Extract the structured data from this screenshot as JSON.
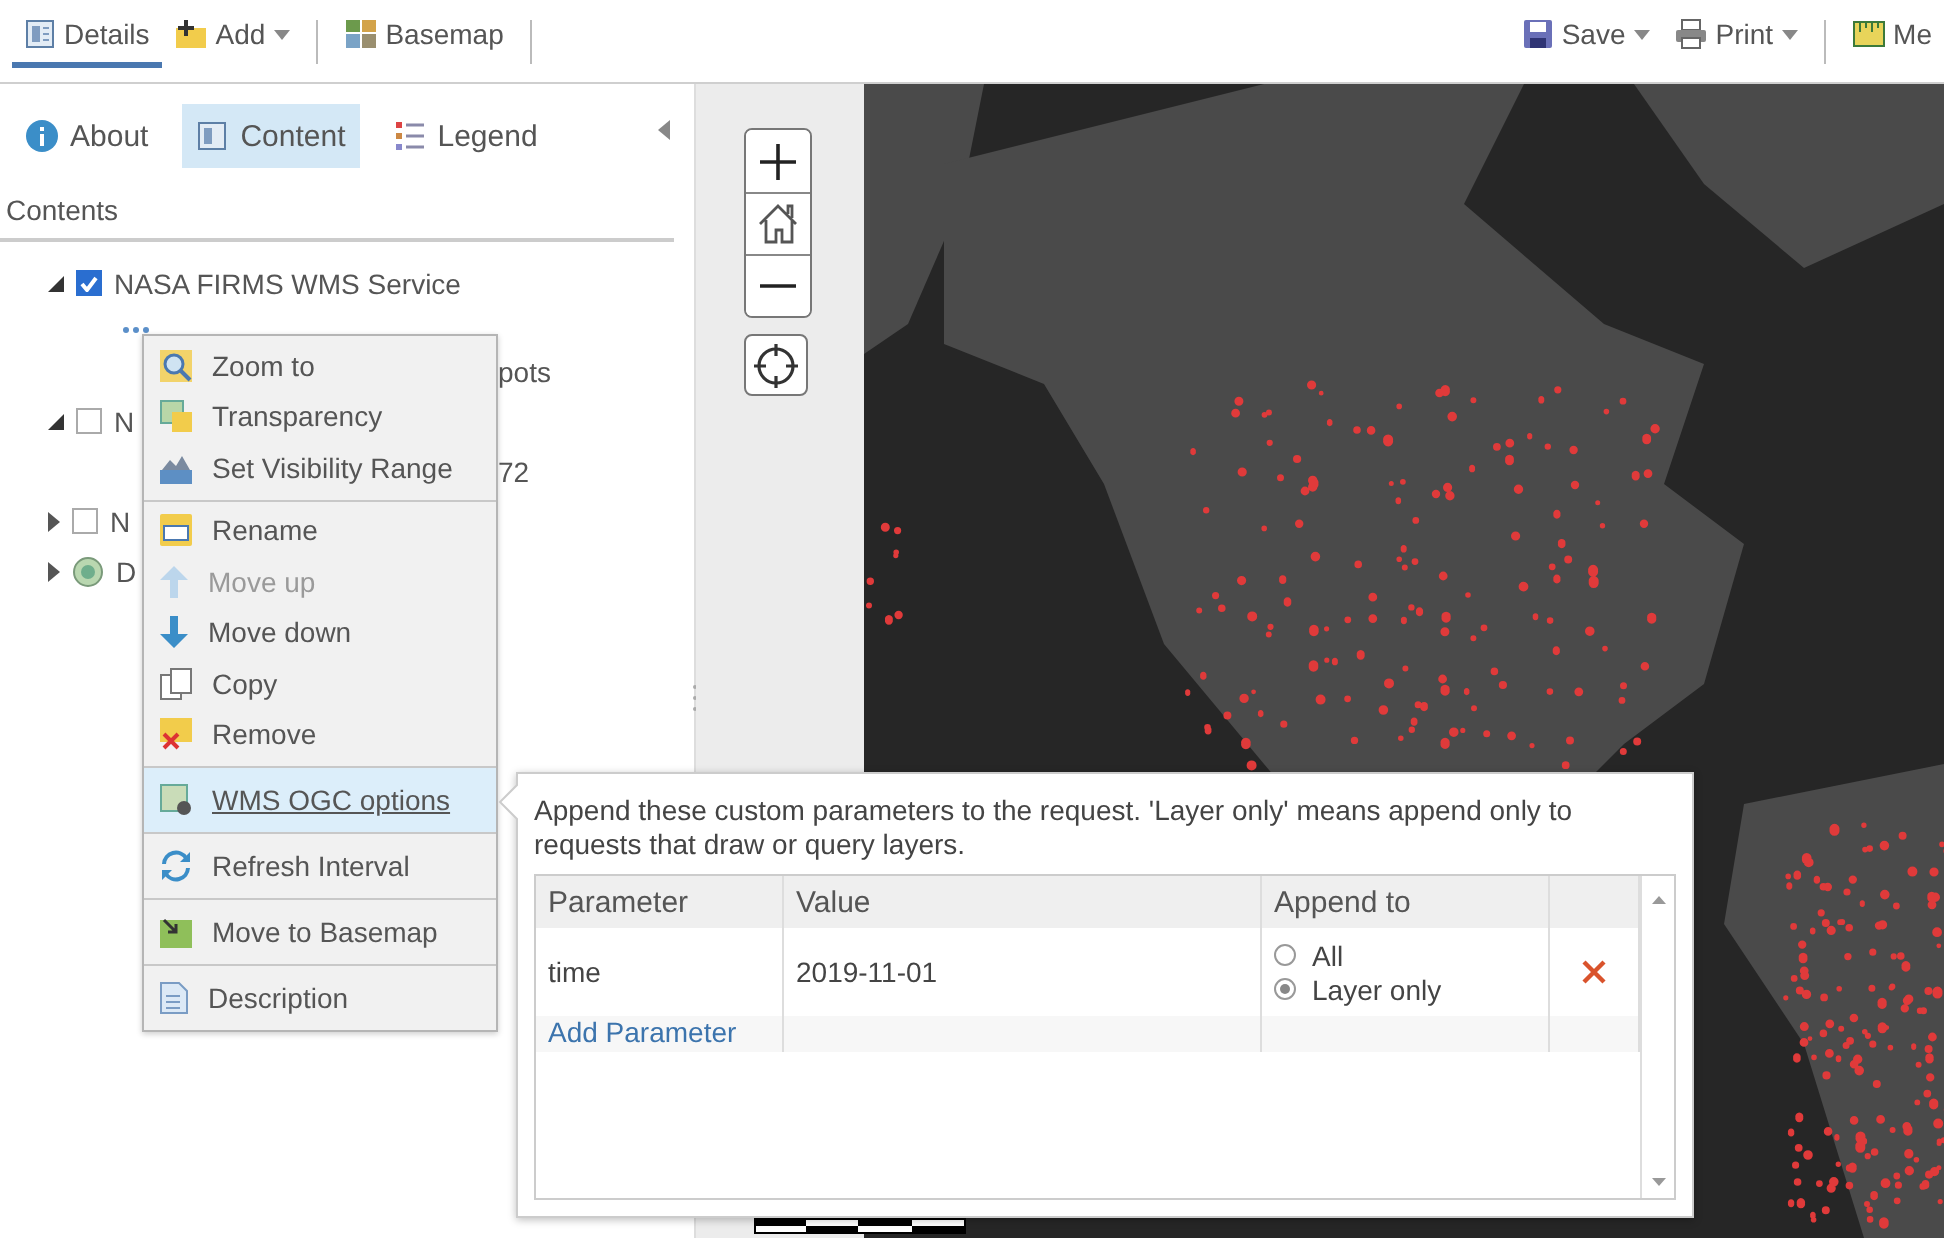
{
  "toolbar": {
    "left": [
      {
        "kind": "button",
        "label": "Details",
        "selected": true,
        "dropdown": false
      },
      {
        "kind": "button",
        "label": "Add",
        "selected": false,
        "dropdown": true
      },
      {
        "kind": "separator"
      },
      {
        "kind": "button",
        "label": "Basemap",
        "selected": false,
        "dropdown": false
      },
      {
        "kind": "separator"
      }
    ],
    "right": [
      {
        "kind": "button",
        "label": "Save",
        "selected": false,
        "dropdown": true
      },
      {
        "kind": "button",
        "label": "Print",
        "selected": false,
        "dropdown": true
      },
      {
        "kind": "separator"
      },
      {
        "kind": "button",
        "label": "Me",
        "selected": false,
        "dropdown": false
      }
    ]
  },
  "side_panel": {
    "tabs": [
      {
        "label": "About",
        "selected": false
      },
      {
        "label": "Content",
        "selected": true
      },
      {
        "label": "Legend",
        "selected": false
      }
    ],
    "heading": "Contents",
    "layers": [
      {
        "kind": "layer",
        "label": "NASA FIRMS WMS Service",
        "checked": true,
        "expanded": true,
        "options_open": true,
        "children": [
          {
            "label": "pots"
          }
        ]
      },
      {
        "kind": "layer",
        "label": "N",
        "checked": false,
        "expanded": true,
        "options_open": false,
        "children": [
          {
            "label": "72"
          }
        ]
      },
      {
        "kind": "layer",
        "label": "N",
        "checked": false,
        "expanded": false,
        "options_open": false
      },
      {
        "kind": "basemap",
        "label": "D",
        "expanded": false,
        "options_open": false
      }
    ]
  },
  "layer_menu": {
    "groups": [
      [
        {
          "label": "Zoom to",
          "disabled": false,
          "selected": false
        },
        {
          "label": "Transparency",
          "disabled": false,
          "selected": false
        },
        {
          "label": "Set Visibility Range",
          "disabled": false,
          "selected": false
        }
      ],
      [
        {
          "label": "Rename",
          "disabled": false,
          "selected": false
        },
        {
          "label": "Move up",
          "disabled": true,
          "selected": false
        },
        {
          "label": "Move down",
          "disabled": false,
          "selected": false
        },
        {
          "label": "Copy",
          "disabled": false,
          "selected": false
        },
        {
          "label": "Remove",
          "disabled": false,
          "selected": false
        }
      ],
      [
        {
          "label": "WMS OGC options",
          "disabled": false,
          "selected": true
        }
      ],
      [
        {
          "label": "Refresh Interval",
          "disabled": false,
          "selected": false
        }
      ],
      [
        {
          "label": "Move to Basemap",
          "disabled": false,
          "selected": false
        }
      ],
      [
        {
          "label": "Description",
          "disabled": false,
          "selected": false
        }
      ]
    ]
  },
  "wms_popup": {
    "description": "Append these custom parameters to the request. 'Layer only' means append only to requests that draw or query layers.",
    "columns": [
      "Parameter",
      "Value",
      "Append to"
    ],
    "rows": [
      {
        "parameter": "time",
        "value": "2019-11-01",
        "options": [
          {
            "label": "All",
            "selected": false
          },
          {
            "label": "Layer only",
            "selected": true
          }
        ]
      }
    ],
    "add_link": "Add Parameter"
  }
}
